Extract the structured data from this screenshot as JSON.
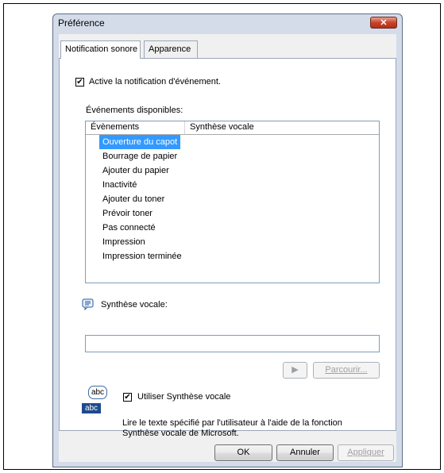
{
  "dialog": {
    "title": "Préférence",
    "close_symbol": "✕"
  },
  "tabs": [
    {
      "label": "Notification sonore"
    },
    {
      "label": "Apparence"
    }
  ],
  "activate_notification": {
    "label": "Active la notification d'événement.",
    "checked": true
  },
  "events": {
    "section_label": "Événements disponibles:",
    "columns": [
      "Évènements",
      "Synthèse vocale"
    ],
    "rows": [
      "Ouverture du capot",
      "Bourrage de papier",
      "Ajouter du papier",
      "Inactivité",
      "Ajouter du toner",
      "Prévoir toner",
      "Pas connecté",
      "Impression",
      "Impression terminée"
    ],
    "selected_index": 0
  },
  "speech": {
    "label": "Synthèse vocale:",
    "value": "",
    "play_icon": "play-icon",
    "browse_label": "Parcourir...",
    "use_label": "Utiliser Synthèse vocale",
    "use_checked": true,
    "description_line1": "Lire le texte spécifié par l'utilisateur à l'aide de la fonction",
    "description_line2": "Synthèse vocale de Microsoft.",
    "icon_text_top": "abc",
    "icon_text_bottom": "abc"
  },
  "buttons": {
    "ok": "OK",
    "cancel": "Annuler",
    "apply": "Appliquer"
  },
  "colors": {
    "selection": "#3399ff",
    "close_button": "#c7442b"
  }
}
